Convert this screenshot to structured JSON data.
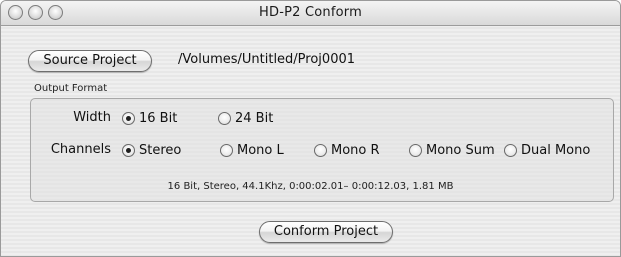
{
  "window": {
    "title": "HD-P2 Conform"
  },
  "source": {
    "button_label": "Source Project",
    "path": "/Volumes/Untitled/Proj0001"
  },
  "output_format": {
    "label": "Output Format",
    "width": {
      "label": "Width",
      "options": [
        {
          "label": "16 Bit",
          "checked": true
        },
        {
          "label": "24 Bit",
          "checked": false
        }
      ]
    },
    "channels": {
      "label": "Channels",
      "options": [
        {
          "label": "Stereo",
          "checked": true
        },
        {
          "label": "Mono L",
          "checked": false
        },
        {
          "label": "Mono R",
          "checked": false
        },
        {
          "label": "Mono Sum",
          "checked": false
        },
        {
          "label": "Dual Mono",
          "checked": false
        }
      ]
    },
    "summary": "16 Bit, Stereo, 44.1Khz,  0:00:02.01– 0:00:12.03, 1.81 MB"
  },
  "actions": {
    "conform_label": "Conform Project"
  }
}
